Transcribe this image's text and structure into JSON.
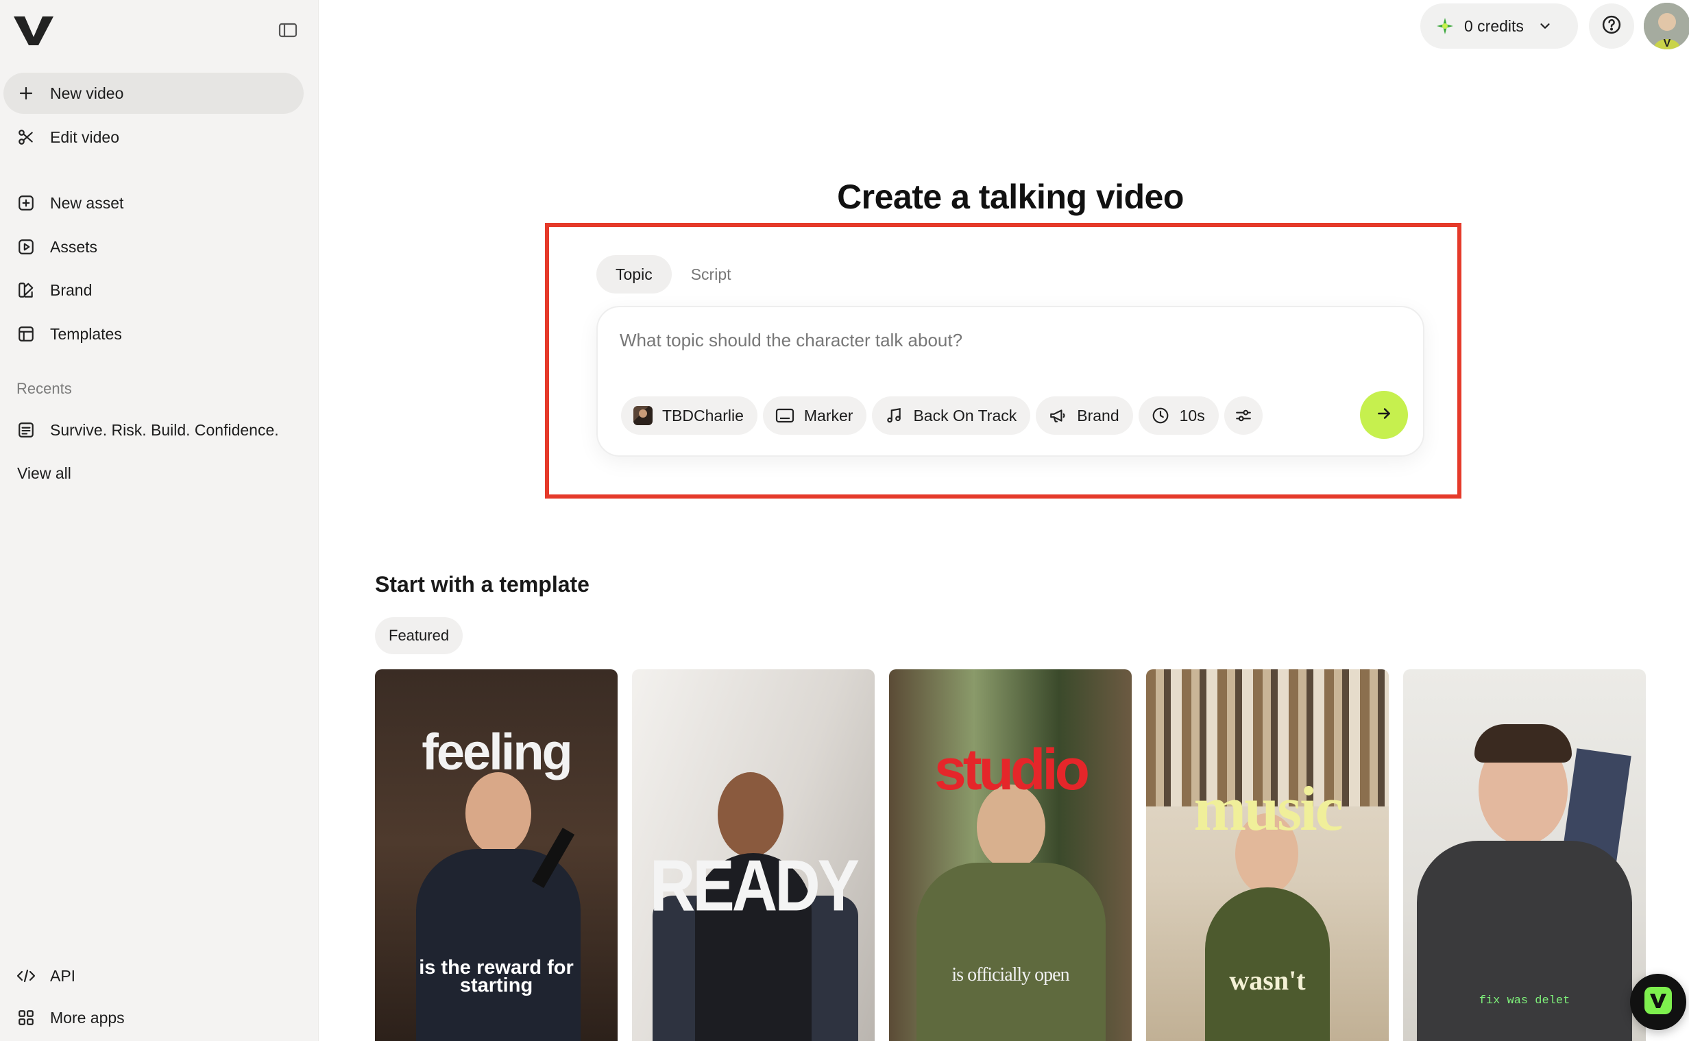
{
  "sidebar": {
    "new_video": "New video",
    "edit_video": "Edit video",
    "new_asset": "New asset",
    "assets": "Assets",
    "brand": "Brand",
    "templates": "Templates",
    "recents_label": "Recents",
    "recent_items": [
      "Survive. Risk. Build. Confidence."
    ],
    "view_all": "View all",
    "api": "API",
    "more_apps": "More apps"
  },
  "header": {
    "credits": "0 credits"
  },
  "main": {
    "title": "Create a talking video",
    "tabs": [
      "Topic",
      "Script"
    ],
    "active_tab": "Topic",
    "prompt_placeholder": "What topic should the character talk about?",
    "chips": {
      "character": "TBDCharlie",
      "caption": "Marker",
      "music": "Back On Track",
      "brand": "Brand",
      "duration": "10s"
    }
  },
  "templates": {
    "title": "Start with a template",
    "filter": "Featured",
    "cards": [
      {
        "top_text": "feeling",
        "bottom_text": "is the reward for starting"
      },
      {
        "top_text": "READY",
        "bottom_text": ""
      },
      {
        "top_text": "studio",
        "bottom_text": "is officially open"
      },
      {
        "top_text": "music",
        "bottom_text": "wasn't"
      },
      {
        "top_text": "",
        "bottom_text": "fix was delet"
      }
    ]
  },
  "colors": {
    "accent_green": "#c6f04e",
    "highlight_red": "#e53a2a",
    "sidebar_bg": "#f4f3f2"
  }
}
